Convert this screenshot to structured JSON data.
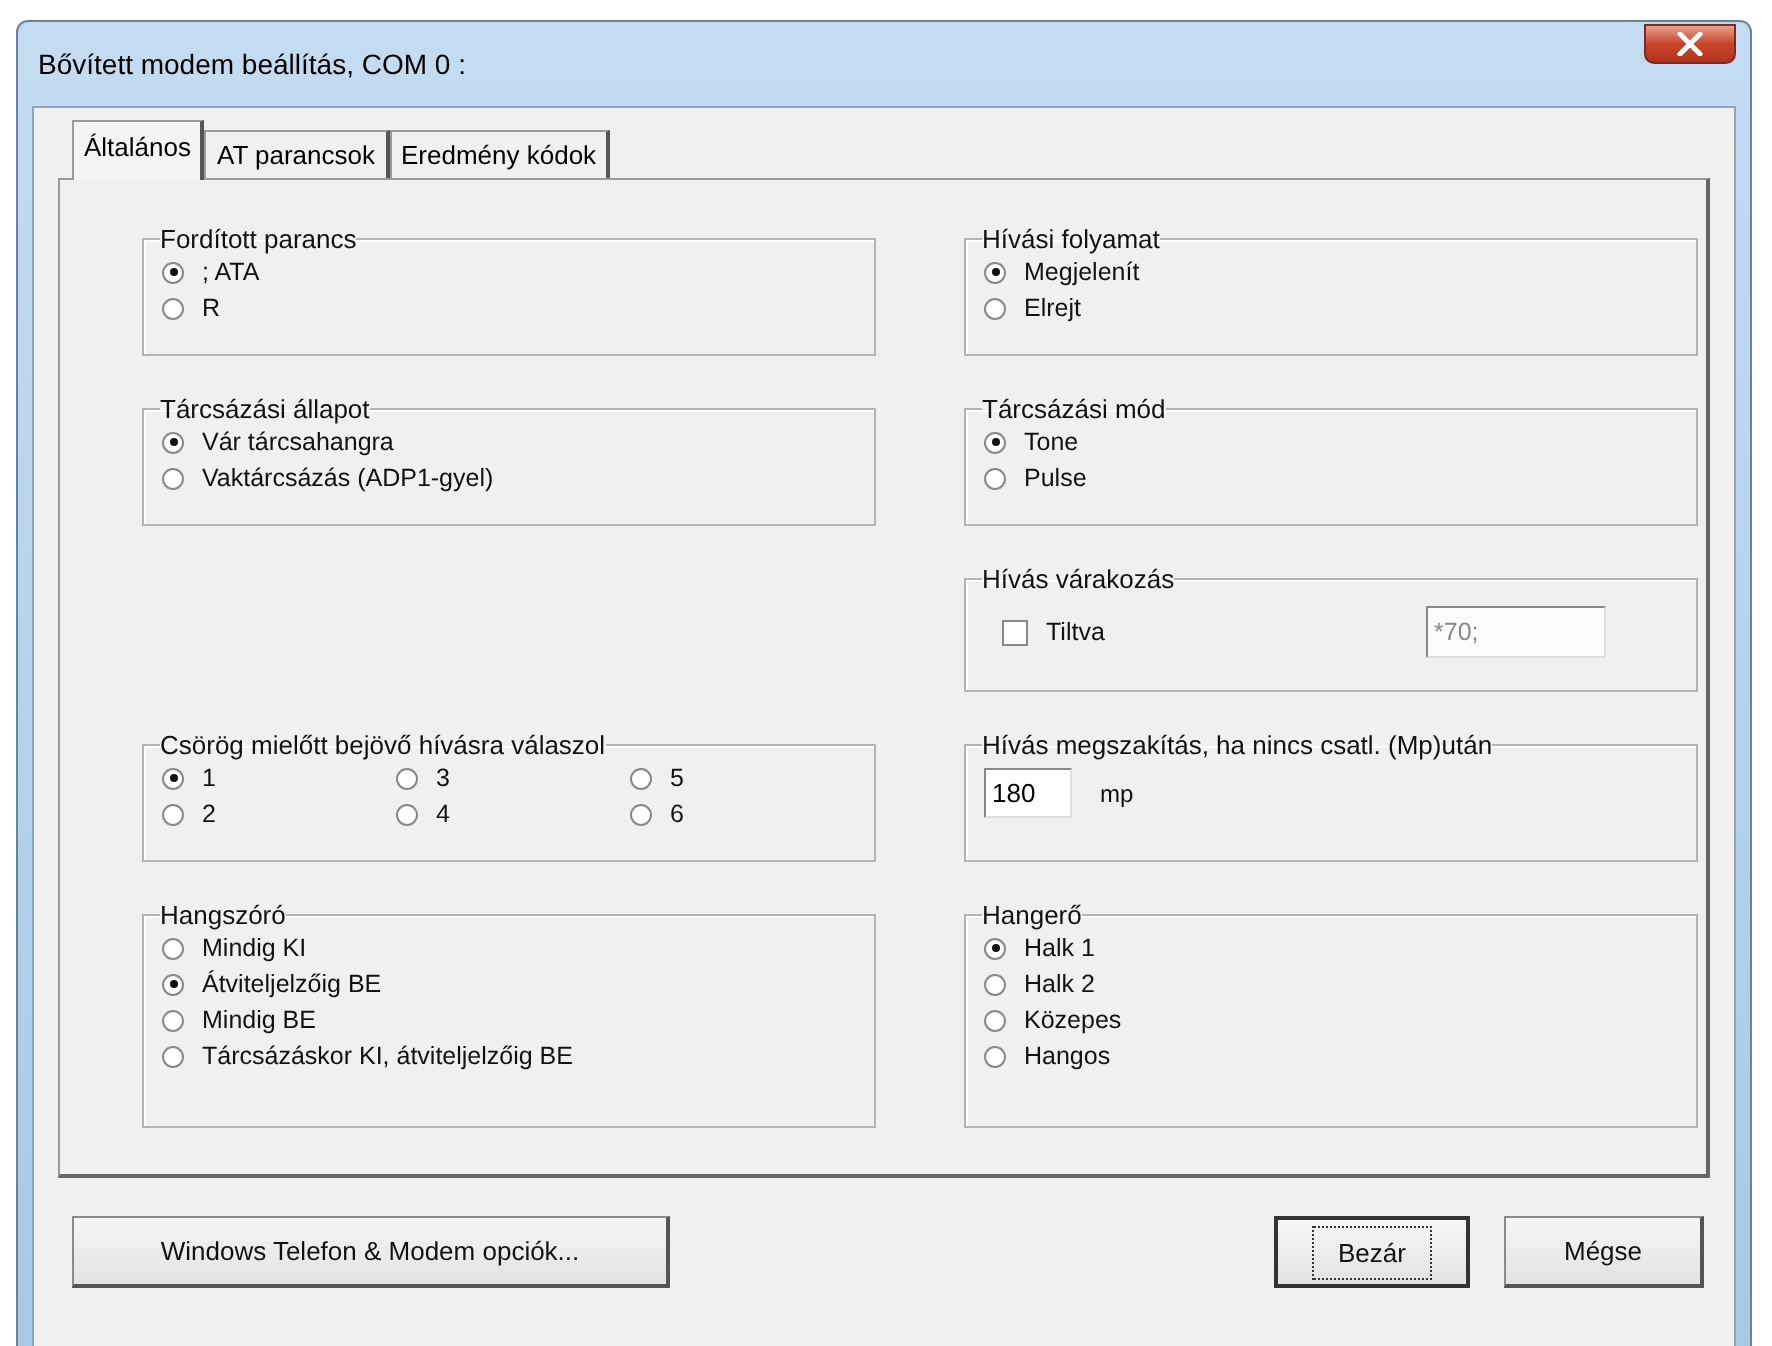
{
  "window": {
    "title": "Bővített modem beállítás, COM 0 :"
  },
  "tabs": [
    {
      "label": "Általános",
      "selected": true
    },
    {
      "label": "AT parancsok",
      "selected": false
    },
    {
      "label": "Eredmény kódok",
      "selected": false
    }
  ],
  "left_groups": [
    {
      "title": "Fordított parancs",
      "kind": "radio",
      "options": [
        {
          "label": "; ATA",
          "selected": true
        },
        {
          "label": "R",
          "selected": false
        }
      ]
    },
    {
      "title": "Tárcsázási állapot",
      "kind": "radio",
      "options": [
        {
          "label": "Vár tárcsahangra",
          "selected": true
        },
        {
          "label": "Vaktárcsázás (ADP1-gyel)",
          "selected": false
        }
      ]
    },
    {
      "title": "Csörög mielőtt bejövő hívásra válaszol",
      "kind": "radio_grid",
      "options": [
        {
          "label": "1",
          "selected": true
        },
        {
          "label": "2",
          "selected": false
        },
        {
          "label": "3",
          "selected": false
        },
        {
          "label": "4",
          "selected": false
        },
        {
          "label": "5",
          "selected": false
        },
        {
          "label": "6",
          "selected": false
        }
      ]
    },
    {
      "title": "Hangszóró",
      "kind": "radio",
      "options": [
        {
          "label": "Mindig KI",
          "selected": false
        },
        {
          "label": "Átviteljelzőig BE",
          "selected": true
        },
        {
          "label": "Mindig BE",
          "selected": false
        },
        {
          "label": "Tárcsázáskor KI, átviteljelzőig BE",
          "selected": false
        }
      ]
    }
  ],
  "right_groups": [
    {
      "title": "Hívási folyamat",
      "kind": "radio",
      "options": [
        {
          "label": "Megjelenít",
          "selected": true
        },
        {
          "label": "Elrejt",
          "selected": false
        }
      ]
    },
    {
      "title": "Tárcsázási mód",
      "kind": "radio",
      "options": [
        {
          "label": "Tone",
          "selected": true
        },
        {
          "label": "Pulse",
          "selected": false
        }
      ]
    },
    {
      "title": "Hívás várakozás",
      "kind": "checkbox_field",
      "checkbox": {
        "label": "Tiltva",
        "checked": false
      },
      "field": {
        "value": "*70;",
        "disabled": true
      }
    },
    {
      "title": "Hívás megszakítás, ha nincs csatl. (Mp)után",
      "kind": "number_field",
      "field": {
        "value": "180"
      },
      "unit": "mp"
    },
    {
      "title": "Hangerő",
      "kind": "radio",
      "options": [
        {
          "label": "Halk 1",
          "selected": true
        },
        {
          "label": "Halk 2",
          "selected": false
        },
        {
          "label": "Közepes",
          "selected": false
        },
        {
          "label": "Hangos",
          "selected": false
        }
      ]
    }
  ],
  "buttons": [
    {
      "label": "Windows Telefon & Modem opciók...",
      "focused": false
    },
    {
      "label": "Bezár",
      "focused": true
    },
    {
      "label": "Mégse",
      "focused": false
    }
  ]
}
